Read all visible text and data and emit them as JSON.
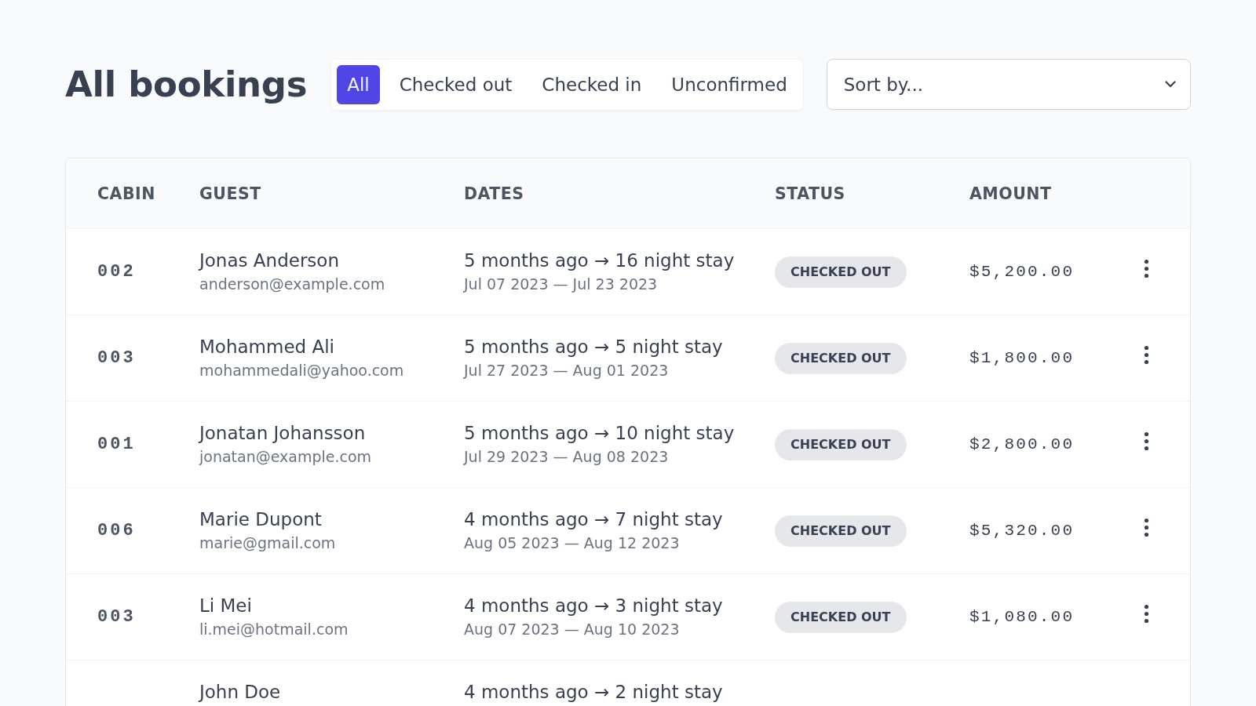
{
  "title": "All bookings",
  "filters": [
    {
      "label": "All",
      "selected": true
    },
    {
      "label": "Checked out",
      "selected": false
    },
    {
      "label": "Checked in",
      "selected": false
    },
    {
      "label": "Unconfirmed",
      "selected": false
    }
  ],
  "sort": {
    "label": "Sort by..."
  },
  "table": {
    "columns": [
      "CABIN",
      "GUEST",
      "DATES",
      "STATUS",
      "AMOUNT"
    ],
    "rows": [
      {
        "cabin": "002",
        "guest_name": "Jonas Anderson",
        "guest_email": "anderson@example.com",
        "dates_summary": "5 months ago → 16 night stay",
        "date_range": "Jul 07 2023 — Jul 23 2023",
        "status": "CHECKED OUT",
        "amount": "$5,200.00"
      },
      {
        "cabin": "003",
        "guest_name": "Mohammed Ali",
        "guest_email": "mohammedali@yahoo.com",
        "dates_summary": "5 months ago → 5 night stay",
        "date_range": "Jul 27 2023 — Aug 01 2023",
        "status": "CHECKED OUT",
        "amount": "$1,800.00"
      },
      {
        "cabin": "001",
        "guest_name": "Jonatan Johansson",
        "guest_email": "jonatan@example.com",
        "dates_summary": "5 months ago → 10 night stay",
        "date_range": "Jul 29 2023 — Aug 08 2023",
        "status": "CHECKED OUT",
        "amount": "$2,800.00"
      },
      {
        "cabin": "006",
        "guest_name": "Marie Dupont",
        "guest_email": "marie@gmail.com",
        "dates_summary": "4 months ago → 7 night stay",
        "date_range": "Aug 05 2023 — Aug 12 2023",
        "status": "CHECKED OUT",
        "amount": "$5,320.00"
      },
      {
        "cabin": "003",
        "guest_name": "Li Mei",
        "guest_email": "li.mei@hotmail.com",
        "dates_summary": "4 months ago → 3 night stay",
        "date_range": "Aug 07 2023 — Aug 10 2023",
        "status": "CHECKED OUT",
        "amount": "$1,080.00"
      },
      {
        "guest_name": "John Doe",
        "dates_summary": "4 months ago → 2 night stay"
      }
    ]
  }
}
